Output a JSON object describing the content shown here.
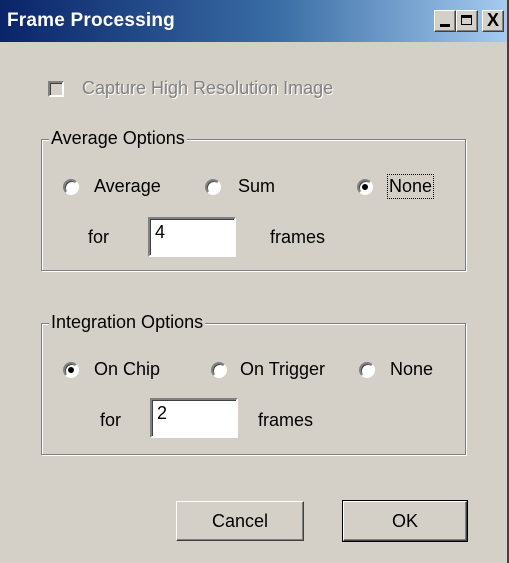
{
  "window": {
    "title": "Frame Processing",
    "controls": {
      "minimize": "_",
      "close": "X"
    }
  },
  "capture": {
    "label": "Capture High Resolution Image",
    "checked": false,
    "enabled": false
  },
  "average_options": {
    "title": "Average Options",
    "options": [
      "Average",
      "Sum",
      "None"
    ],
    "selected": "None",
    "for_label": "for",
    "frames_value": "4",
    "frames_label": "frames"
  },
  "integration_options": {
    "title": "Integration Options",
    "options": [
      "On Chip",
      "On Trigger",
      "None"
    ],
    "selected": "On Chip",
    "for_label": "for",
    "frames_value": "2",
    "frames_label": "frames"
  },
  "buttons": {
    "cancel": "Cancel",
    "ok": "OK"
  }
}
